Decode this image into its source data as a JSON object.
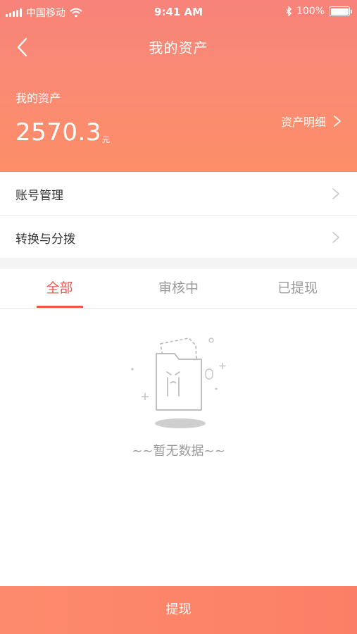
{
  "status_bar": {
    "carrier": "中国移动",
    "time": "9:41 AM",
    "battery": "100%"
  },
  "nav": {
    "title": "我的资产"
  },
  "asset": {
    "label": "我的资产",
    "amount": "2570.3",
    "unit": "元",
    "detail_link": "资产明细"
  },
  "menu": [
    {
      "label": "账号管理"
    },
    {
      "label": "转换与分拨"
    }
  ],
  "tabs": [
    {
      "label": "全部",
      "active": true
    },
    {
      "label": "审核中",
      "active": false
    },
    {
      "label": "已提现",
      "active": false
    }
  ],
  "empty_state": {
    "message": "~~暂无数据~~"
  },
  "bottom_button": {
    "label": "提现"
  },
  "colors": {
    "header": "#fa8a74",
    "accent": "#f0554a",
    "button": "#fd8a6c"
  }
}
